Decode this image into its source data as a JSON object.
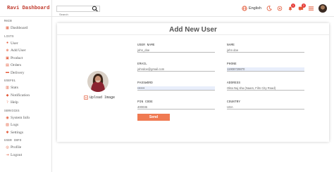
{
  "sidebar": {
    "logo": "Ravi Dashboard",
    "sections": [
      {
        "title": "MAIN",
        "items": [
          {
            "label": "Dashboard",
            "icon": "grid-icon"
          }
        ]
      },
      {
        "title": "LISTS",
        "items": [
          {
            "label": "User",
            "icon": "user-icon"
          },
          {
            "label": "Add User",
            "icon": "plus-icon"
          },
          {
            "label": "Product",
            "icon": "box-icon"
          },
          {
            "label": "Orders",
            "icon": "cart-icon"
          },
          {
            "label": "Delivery",
            "icon": "truck-icon"
          }
        ]
      },
      {
        "title": "USEFUL",
        "items": [
          {
            "label": "Stats",
            "icon": "chart-icon"
          },
          {
            "label": "Notification",
            "icon": "bell-icon"
          },
          {
            "label": "Help",
            "icon": "help-icon"
          }
        ]
      },
      {
        "title": "SERVICES",
        "items": [
          {
            "label": "System Info",
            "icon": "info-icon"
          },
          {
            "label": "Logs",
            "icon": "logs-icon"
          },
          {
            "label": "Settings",
            "icon": "gear-icon"
          }
        ]
      },
      {
        "title": "USER INFO",
        "items": [
          {
            "label": "Profile",
            "icon": "profile-icon"
          },
          {
            "label": "Logout",
            "icon": "logout-icon"
          }
        ]
      }
    ]
  },
  "topbar": {
    "search_placeholder": "Search",
    "language": "English",
    "notifications_count": "1",
    "messages_count": "2",
    "accent": "#e53935"
  },
  "form": {
    "title": "Add New User",
    "upload_label": "Upload Image",
    "fields": {
      "username": {
        "label": "USER NAME",
        "value": "john_doe"
      },
      "name": {
        "label": "NAME",
        "value": "john doe"
      },
      "email": {
        "label": "EMAIL",
        "value": "johndoe@gmail.com"
      },
      "phone": {
        "label": "PHONE",
        "value": "11908729870"
      },
      "password": {
        "label": "PASSWORD",
        "value": "•••••••"
      },
      "address": {
        "label": "ADDRESS",
        "value": "Okta Nuj sha (Naam, Film City Road)"
      },
      "pincode": {
        "label": "PIN CODE",
        "value": "400036"
      },
      "country": {
        "label": "COUNTRY",
        "value": "USA"
      }
    },
    "send_label": "Send",
    "button_color": "#f07a52"
  }
}
